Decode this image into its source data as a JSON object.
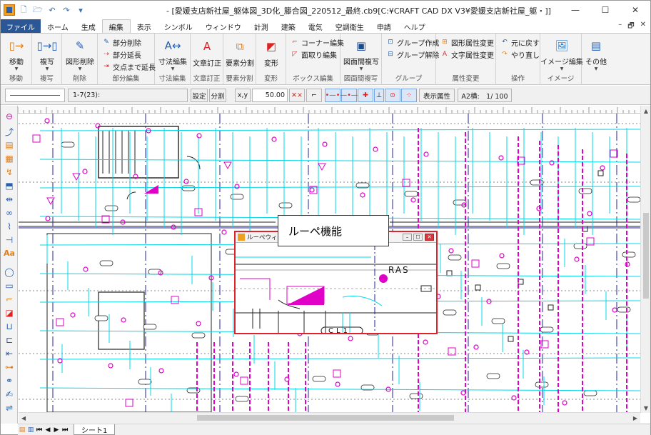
{
  "window": {
    "title": "- [愛媛支店新社屋_躯体図_3D化_籐合図_220512_最終.cb9[C:¥CRAFT CAD DX V3¥愛媛支店新社屋_躯・]]",
    "controls": {
      "minimize": "—",
      "maximize": "☐",
      "close": "✕"
    }
  },
  "tabs": [
    "ファイル",
    "ホーム",
    "生成",
    "編集",
    "表示",
    "シンボル",
    "ウィンドウ",
    "計測",
    "建築",
    "電気",
    "空調衛生",
    "申請",
    "ヘルプ"
  ],
  "active_tab": "編集",
  "ribbon": {
    "move": {
      "label": "移動",
      "group": "移動"
    },
    "copy": {
      "label": "複写",
      "group": "複写"
    },
    "delete": {
      "label": "図形削除",
      "group": "削除"
    },
    "partial": {
      "items": [
        "部分削除",
        "部分延長",
        "交点まで延長"
      ],
      "group": "部分編集"
    },
    "dim": {
      "label": "寸法編集",
      "group": "寸法編集"
    },
    "text": {
      "label": "文章訂正",
      "group": "文章訂正"
    },
    "split": {
      "label": "要素分割",
      "group": "要素分割"
    },
    "transform": {
      "label": "変形",
      "group": "変形"
    },
    "box": {
      "items": [
        "コーナー編集",
        "面取り編集"
      ],
      "group": "ボックス編集"
    },
    "interdrawing": {
      "label": "図面間複写",
      "group": "図面間複写"
    },
    "grouping": {
      "items": [
        "グループ作成",
        "グループ解除"
      ],
      "group": "グループ"
    },
    "attr": {
      "items": [
        "図形属性変更",
        "文字属性変更"
      ],
      "group": "属性変更"
    },
    "op": {
      "items": [
        "元に戻す",
        "やり直し"
      ],
      "group": "操作"
    },
    "image": {
      "label": "イメージ編集",
      "group": "イメージ"
    },
    "other": {
      "label": "その他"
    }
  },
  "cmdbar": {
    "layer": "1-7(23):",
    "settings": "設定",
    "divide": "分割",
    "value": "50.00",
    "display_attr": "表示属性",
    "scale": "A2横:　1/ 100"
  },
  "loupe": {
    "title": "ルーペウィンドウ",
    "label_ras": "RAS",
    "label_cl": "CL1"
  },
  "callout": "ルーペ機能",
  "sheet": {
    "tab": "シート1"
  },
  "colors": {
    "accent": "#2b5797",
    "cyan": "#00d8e8",
    "magenta": "#e000c8",
    "blue": "#2020a0",
    "red": "#e0222a"
  }
}
